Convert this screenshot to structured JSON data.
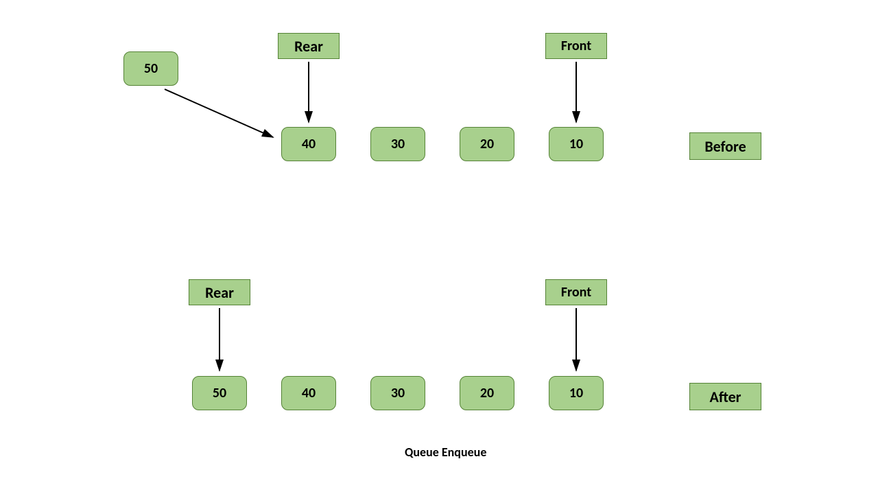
{
  "before": {
    "incoming": "50",
    "rear_label": "Rear",
    "front_label": "Front",
    "state_label": "Before",
    "queue": [
      "40",
      "30",
      "20",
      "10"
    ]
  },
  "after": {
    "rear_label": "Rear",
    "front_label": "Front",
    "state_label": "After",
    "queue": [
      "50",
      "40",
      "30",
      "20",
      "10"
    ]
  },
  "caption": "Queue Enqueue",
  "chart_data": {
    "type": "diagram",
    "title": "Queue Enqueue",
    "operation": "enqueue",
    "inserted_value": 50,
    "states": [
      {
        "label": "Before",
        "queue_rear_to_front": [
          40,
          30,
          20,
          10
        ],
        "rear_points_to": 40,
        "front_points_to": 10,
        "incoming_element": 50
      },
      {
        "label": "After",
        "queue_rear_to_front": [
          50,
          40,
          30,
          20,
          10
        ],
        "rear_points_to": 50,
        "front_points_to": 10
      }
    ]
  }
}
